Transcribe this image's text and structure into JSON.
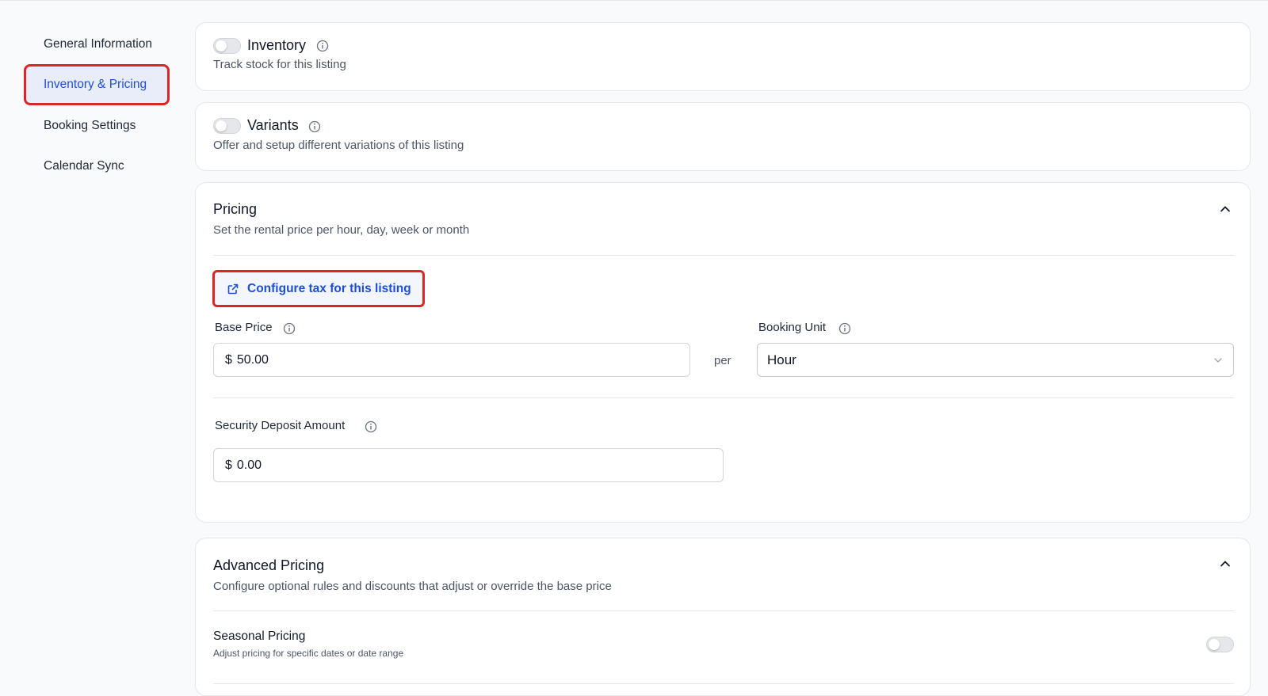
{
  "sidebar": {
    "items": [
      {
        "label": "General Information"
      },
      {
        "label": "Inventory & Pricing",
        "active": true
      },
      {
        "label": "Booking Settings"
      },
      {
        "label": "Calendar Sync"
      }
    ]
  },
  "inventory": {
    "title": "Inventory",
    "subtitle": "Track stock for this listing",
    "enabled": false
  },
  "variants": {
    "title": "Variants",
    "subtitle": "Offer and setup different variations of this listing",
    "enabled": false
  },
  "pricing": {
    "title": "Pricing",
    "subtitle": "Set the rental price per hour, day, week or month",
    "configure_tax_label": "Configure tax for this listing",
    "base_price_label": "Base Price",
    "currency_symbol": "$",
    "base_price_value": "50.00",
    "per_label": "per",
    "booking_unit_label": "Booking Unit",
    "booking_unit_value": "Hour",
    "deposit_label": "Security Deposit Amount",
    "deposit_value": "0.00"
  },
  "advanced_pricing": {
    "title": "Advanced Pricing",
    "subtitle": "Configure optional rules and discounts that adjust or override the base price",
    "seasonal_title": "Seasonal Pricing",
    "seasonal_subtitle": "Adjust pricing for specific dates or date range",
    "seasonal_enabled": false
  },
  "colors": {
    "accent": "#1d4ed8",
    "active_bg": "#e8edf9",
    "highlight": "#dc2626"
  },
  "icons": {
    "info": "info-circle-icon",
    "external": "external-link-icon",
    "chevron_up": "chevron-up-icon",
    "chevron_down": "chevron-down-icon"
  }
}
